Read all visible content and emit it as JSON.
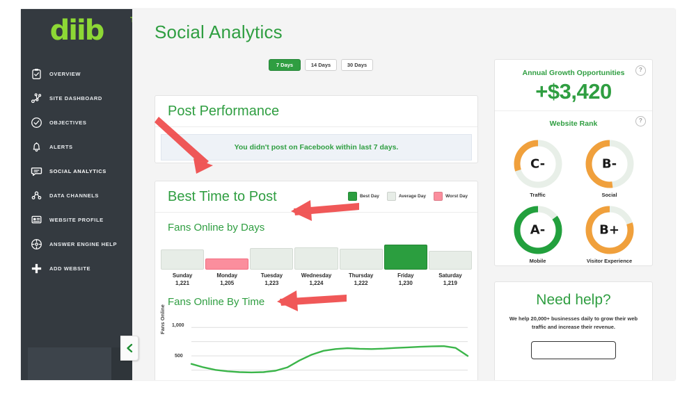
{
  "sidebar": {
    "logo": {
      "text": "diib",
      "tm": "TM"
    },
    "items": [
      {
        "label": "OVERVIEW",
        "icon": "clipboard-check-icon",
        "active": false
      },
      {
        "label": "SITE DASHBOARD",
        "icon": "network-nodes-icon",
        "active": false
      },
      {
        "label": "OBJECTIVES",
        "icon": "check-circle-icon",
        "active": false
      },
      {
        "label": "ALERTS",
        "icon": "bell-icon",
        "active": false
      },
      {
        "label": "SOCIAL ANALYTICS",
        "icon": "chat-bubble-icon",
        "active": true
      },
      {
        "label": "DATA CHANNELS",
        "icon": "share-nodes-icon",
        "active": false
      },
      {
        "label": "WEBSITE PROFILE",
        "icon": "id-card-icon",
        "active": false
      },
      {
        "label": "ANSWER ENGINE HELP",
        "icon": "compass-icon",
        "active": false
      },
      {
        "label": "ADD WEBSITE",
        "icon": "plus-icon",
        "active": false
      }
    ],
    "collapse_icon": "chevron-left-icon"
  },
  "header": {
    "title": "Social Analytics",
    "range_tabs": [
      {
        "label": "7 Days",
        "active": true
      },
      {
        "label": "14 Days",
        "active": false
      },
      {
        "label": "30 Days",
        "active": false
      }
    ]
  },
  "post_performance": {
    "title": "Post Performance",
    "notice": "You didn't post on Facebook within last 7 days."
  },
  "best_time": {
    "title": "Best Time to Post",
    "legend": [
      {
        "label": "Best Day",
        "color": "#2b9e3f"
      },
      {
        "label": "Average Day",
        "color": "#e7ede7"
      },
      {
        "label": "Worst Day",
        "color": "#fb8e9d"
      }
    ],
    "days_subtitle": "Fans Online by Days",
    "time_subtitle": "Fans Online By Time"
  },
  "chart_data": [
    {
      "type": "bar",
      "title": "Fans Online by Days",
      "categories": [
        "Sunday",
        "Monday",
        "Tuesday",
        "Wednesday",
        "Thursday",
        "Friday",
        "Saturday"
      ],
      "values": [
        1221,
        1205,
        1223,
        1224,
        1222,
        1230,
        1219
      ],
      "value_labels": [
        "1,221",
        "1,205",
        "1,223",
        "1,224",
        "1,222",
        "1,230",
        "1,219"
      ],
      "states": [
        "average",
        "worst",
        "average",
        "average",
        "average",
        "best",
        "average"
      ],
      "xlabel": "",
      "ylabel": "",
      "ylim": [
        1200,
        1232
      ],
      "grid": false,
      "legend": "top-right"
    },
    {
      "type": "line",
      "title": "Fans Online By Time",
      "ylabel": "Fans Online",
      "xlabel": "",
      "ylim": [
        0,
        1100
      ],
      "ytick_labels": [
        "1,000",
        "500"
      ],
      "yticks": [
        1000,
        500
      ],
      "grid": true,
      "series": [
        {
          "name": "Fans Online",
          "color": "#3bb54a",
          "x": [
            0,
            1,
            2,
            3,
            4,
            5,
            6,
            7,
            8,
            9,
            10,
            11,
            12,
            13,
            14,
            15,
            16,
            17,
            18,
            19,
            20,
            21,
            22,
            23
          ],
          "values": [
            360,
            300,
            255,
            230,
            215,
            210,
            215,
            240,
            300,
            420,
            520,
            590,
            620,
            635,
            625,
            620,
            628,
            640,
            650,
            660,
            668,
            672,
            640,
            500
          ]
        }
      ]
    }
  ],
  "growth": {
    "title": "Annual Growth Opportunities",
    "value": "+$3,420",
    "help_icon": "question-mark-icon"
  },
  "website_rank": {
    "title": "Website Rank",
    "help_icon": "question-mark-icon",
    "gauges": [
      {
        "label": "Traffic",
        "grade": "C-",
        "percent": 30,
        "color": "#f0a03c"
      },
      {
        "label": "Social",
        "grade": "B-",
        "percent": 52,
        "color": "#f0a03c"
      },
      {
        "label": "Mobile",
        "grade": "A-",
        "percent": 85,
        "color": "#22a03d"
      },
      {
        "label": "Visitor Experience",
        "grade": "B+",
        "percent": 80,
        "color": "#f0a03c"
      }
    ]
  },
  "need_help": {
    "title": "Need help?",
    "body": "We help 20,000+ businesses daily to grow their web traffic and increase their revenue."
  }
}
